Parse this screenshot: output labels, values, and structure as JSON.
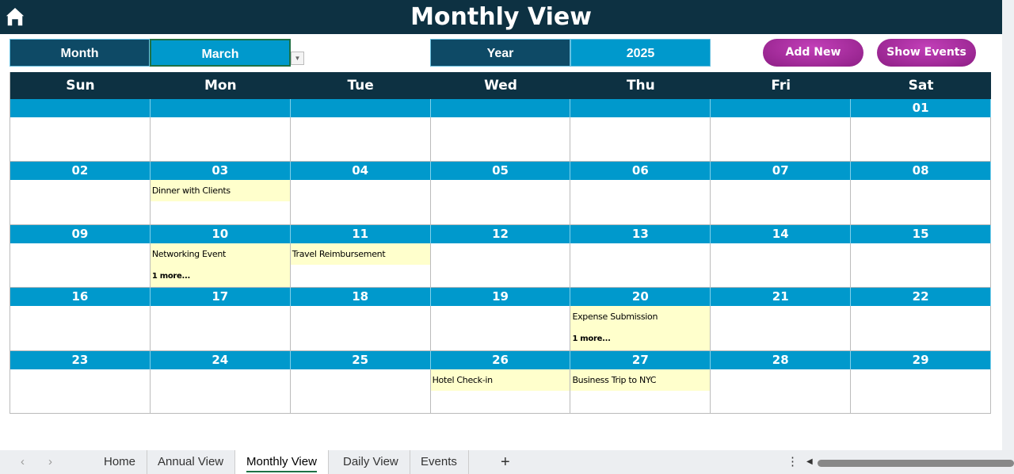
{
  "title": "Monthly View",
  "controls": {
    "month_label": "Month",
    "month_value": "March",
    "year_label": "Year",
    "year_value": "2025",
    "add_new": "Add New",
    "show_events": "Show Events"
  },
  "weekdays": [
    "Sun",
    "Mon",
    "Tue",
    "Wed",
    "Thu",
    "Fri",
    "Sat"
  ],
  "weeks": [
    {
      "dates": [
        "",
        "",
        "",
        "",
        "",
        "",
        "01"
      ],
      "events": [
        null,
        null,
        null,
        null,
        null,
        null,
        null
      ]
    },
    {
      "dates": [
        "02",
        "03",
        "04",
        "05",
        "06",
        "07",
        "08"
      ],
      "events": [
        null,
        {
          "title": "Dinner with Clients"
        },
        null,
        null,
        null,
        null,
        null
      ]
    },
    {
      "dates": [
        "09",
        "10",
        "11",
        "12",
        "13",
        "14",
        "15"
      ],
      "events": [
        null,
        {
          "title": "Networking Event",
          "more": "1 more..."
        },
        {
          "title": "Travel Reimbursement"
        },
        null,
        null,
        null,
        null
      ]
    },
    {
      "dates": [
        "16",
        "17",
        "18",
        "19",
        "20",
        "21",
        "22"
      ],
      "events": [
        null,
        null,
        null,
        null,
        {
          "title": "Expense Submission",
          "more": "1 more..."
        },
        null,
        null
      ]
    },
    {
      "dates": [
        "23",
        "24",
        "25",
        "26",
        "27",
        "28",
        "29"
      ],
      "events": [
        null,
        null,
        null,
        {
          "title": "Hotel Check-in"
        },
        {
          "title": "Business Trip to NYC"
        },
        null,
        null
      ]
    }
  ],
  "sheet_tabs": [
    "Home",
    "Annual View",
    "Monthly View",
    "Daily View",
    "Events"
  ],
  "active_tab": "Monthly View",
  "add_sheet": "+",
  "colors": {
    "header": "#0d3142",
    "date_bar": "#0099cc",
    "event": "#ffffcc",
    "button": "#a02a98"
  }
}
